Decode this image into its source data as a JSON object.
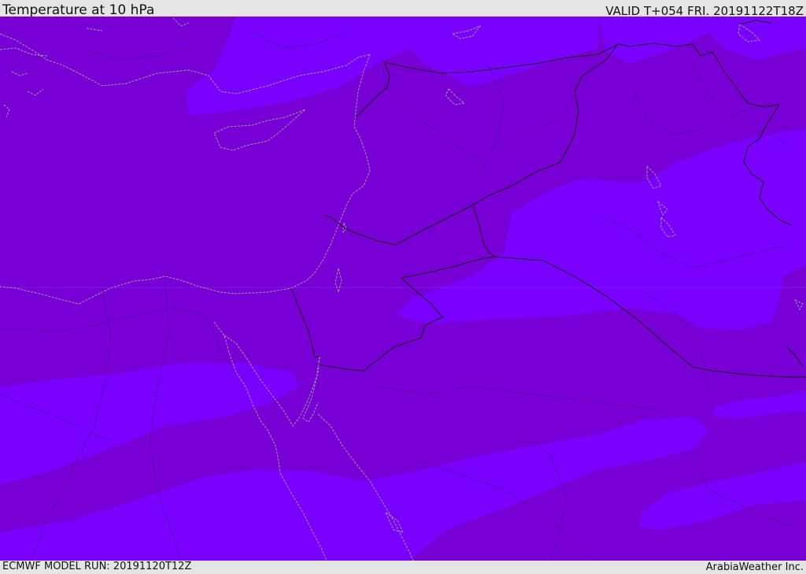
{
  "header": {
    "title": "Temperature at 10 hPa",
    "valid": "VALID T+054 FRI. 20191122T18Z"
  },
  "footer": {
    "model_run": "ECMWF MODEL RUN: 20191120T12Z",
    "credit": "ArabiaWeather Inc."
  },
  "colors": {
    "band_dark": "#7800d6",
    "band_light": "#7a00ff",
    "coastline": "#9a9a9a",
    "border": "#111111",
    "internal_boundary": "#3a0a70",
    "chrome_background": "#e5e5e5"
  },
  "legend": []
}
